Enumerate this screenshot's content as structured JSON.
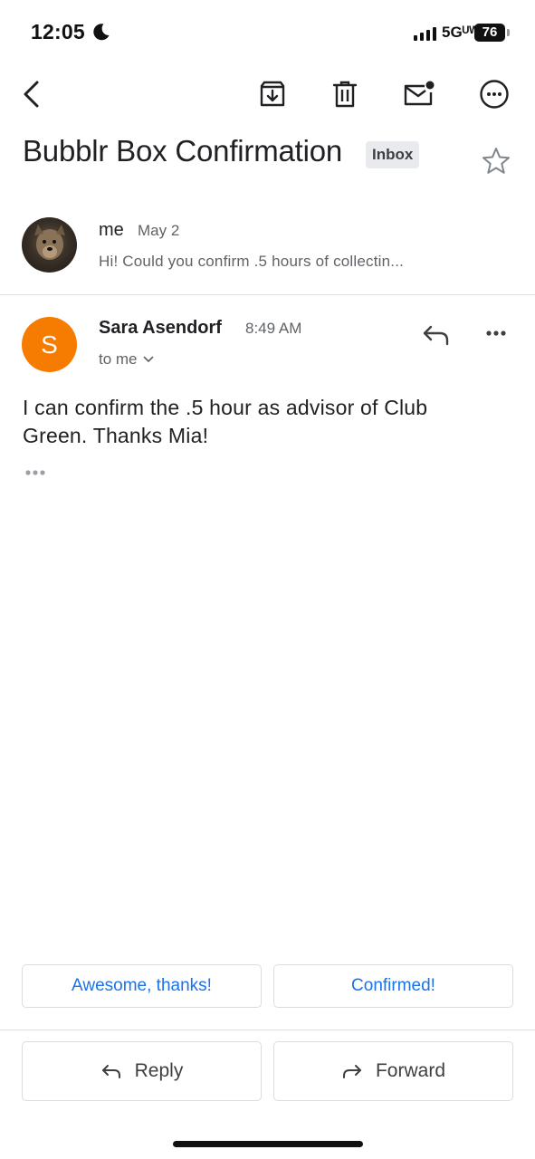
{
  "status_bar": {
    "time": "12:05",
    "network": "5Gᵁᵂ",
    "battery": "76"
  },
  "toolbar": {
    "icons": [
      "back-icon",
      "archive-icon",
      "trash-icon",
      "mark-unread-icon",
      "more-options-icon"
    ]
  },
  "thread": {
    "subject": "Bubblr Box Confirmation",
    "label": "Inbox"
  },
  "collapsed_message": {
    "sender": "me",
    "date": "May 2",
    "snippet": "Hi! Could you confirm .5 hours of collectin..."
  },
  "expanded_message": {
    "avatar_letter": "S",
    "avatar_color": "#f57c00",
    "sender": "Sara Asendorf",
    "time": "8:49 AM",
    "recipient": "to me",
    "body": "I can confirm the .5 hour as advisor of Club Green. Thanks Mia!"
  },
  "smart_replies": [
    "Awesome, thanks!",
    "Confirmed!"
  ],
  "actions": {
    "reply": "Reply",
    "forward": "Forward"
  },
  "colors": {
    "accent": "#1a73e8",
    "avatar_orange": "#f57c00"
  }
}
